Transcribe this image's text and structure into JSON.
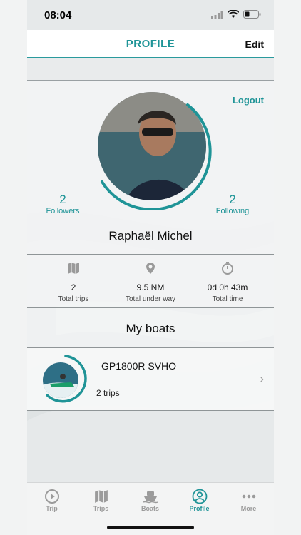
{
  "status_bar": {
    "time": "08:04"
  },
  "nav": {
    "title": "PROFILE",
    "edit_label": "Edit"
  },
  "profile": {
    "logout_label": "Logout",
    "followers": {
      "count": "2",
      "label": "Followers"
    },
    "following": {
      "count": "2",
      "label": "Following"
    },
    "name": "Raphaël Michel"
  },
  "stats": [
    {
      "icon": "map-icon",
      "value": "2",
      "label": "Total trips"
    },
    {
      "icon": "location-pin-icon",
      "value": "9.5 NM",
      "label": "Total under way"
    },
    {
      "icon": "stopwatch-icon",
      "value": "0d 0h 43m",
      "label": "Total time"
    }
  ],
  "boats": {
    "heading": "My boats",
    "items": [
      {
        "name": "GP1800R SVHO",
        "trips": "2 trips"
      }
    ]
  },
  "tabs": [
    {
      "label": "Trip",
      "icon": "play-circle-icon",
      "active": false
    },
    {
      "label": "Trips",
      "icon": "map-icon",
      "active": false
    },
    {
      "label": "Boats",
      "icon": "boat-icon",
      "active": false
    },
    {
      "label": "Profile",
      "icon": "user-circle-icon",
      "active": true
    },
    {
      "label": "More",
      "icon": "more-dots-icon",
      "active": false
    }
  ],
  "colors": {
    "accent": "#1f9497",
    "inactive": "#9b9b9b"
  }
}
